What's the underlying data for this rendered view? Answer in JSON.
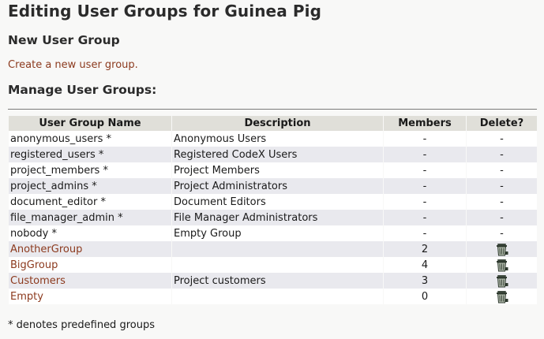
{
  "page": {
    "title": "Editing User Groups for Guinea Pig",
    "new_group_heading": "New User Group",
    "create_link": "Create a new user group.",
    "manage_heading": "Manage User Groups:",
    "footnote": "* denotes predefined groups"
  },
  "table": {
    "headers": [
      "User Group Name",
      "Description",
      "Members",
      "Delete?"
    ],
    "rows": [
      {
        "name": "anonymous_users *",
        "description": "Anonymous Users",
        "members": "-",
        "delete": "-",
        "link": false
      },
      {
        "name": "registered_users *",
        "description": "Registered CodeX Users",
        "members": "-",
        "delete": "-",
        "link": false
      },
      {
        "name": "project_members *",
        "description": "Project Members",
        "members": "-",
        "delete": "-",
        "link": false
      },
      {
        "name": "project_admins *",
        "description": "Project Administrators",
        "members": "-",
        "delete": "-",
        "link": false
      },
      {
        "name": "document_editor *",
        "description": "Document Editors",
        "members": "-",
        "delete": "-",
        "link": false
      },
      {
        "name": "file_manager_admin *",
        "description": "File Manager Administrators",
        "members": "-",
        "delete": "-",
        "link": false
      },
      {
        "name": "nobody *",
        "description": "Empty Group",
        "members": "-",
        "delete": "-",
        "link": false
      },
      {
        "name": "AnotherGroup",
        "description": "",
        "members": "2",
        "delete": "trash-icon",
        "link": true
      },
      {
        "name": "BigGroup",
        "description": "",
        "members": "4",
        "delete": "trash-icon",
        "link": true
      },
      {
        "name": "Customers",
        "description": "Project customers",
        "members": "3",
        "delete": "trash-icon",
        "link": true
      },
      {
        "name": "Empty",
        "description": "",
        "members": "0",
        "delete": "trash-icon",
        "link": true
      }
    ]
  },
  "colors": {
    "link": "#8c3a1e",
    "header_bg": "#e0dfd9",
    "row_odd": "#ffffff",
    "row_even": "#e9e9ee"
  }
}
